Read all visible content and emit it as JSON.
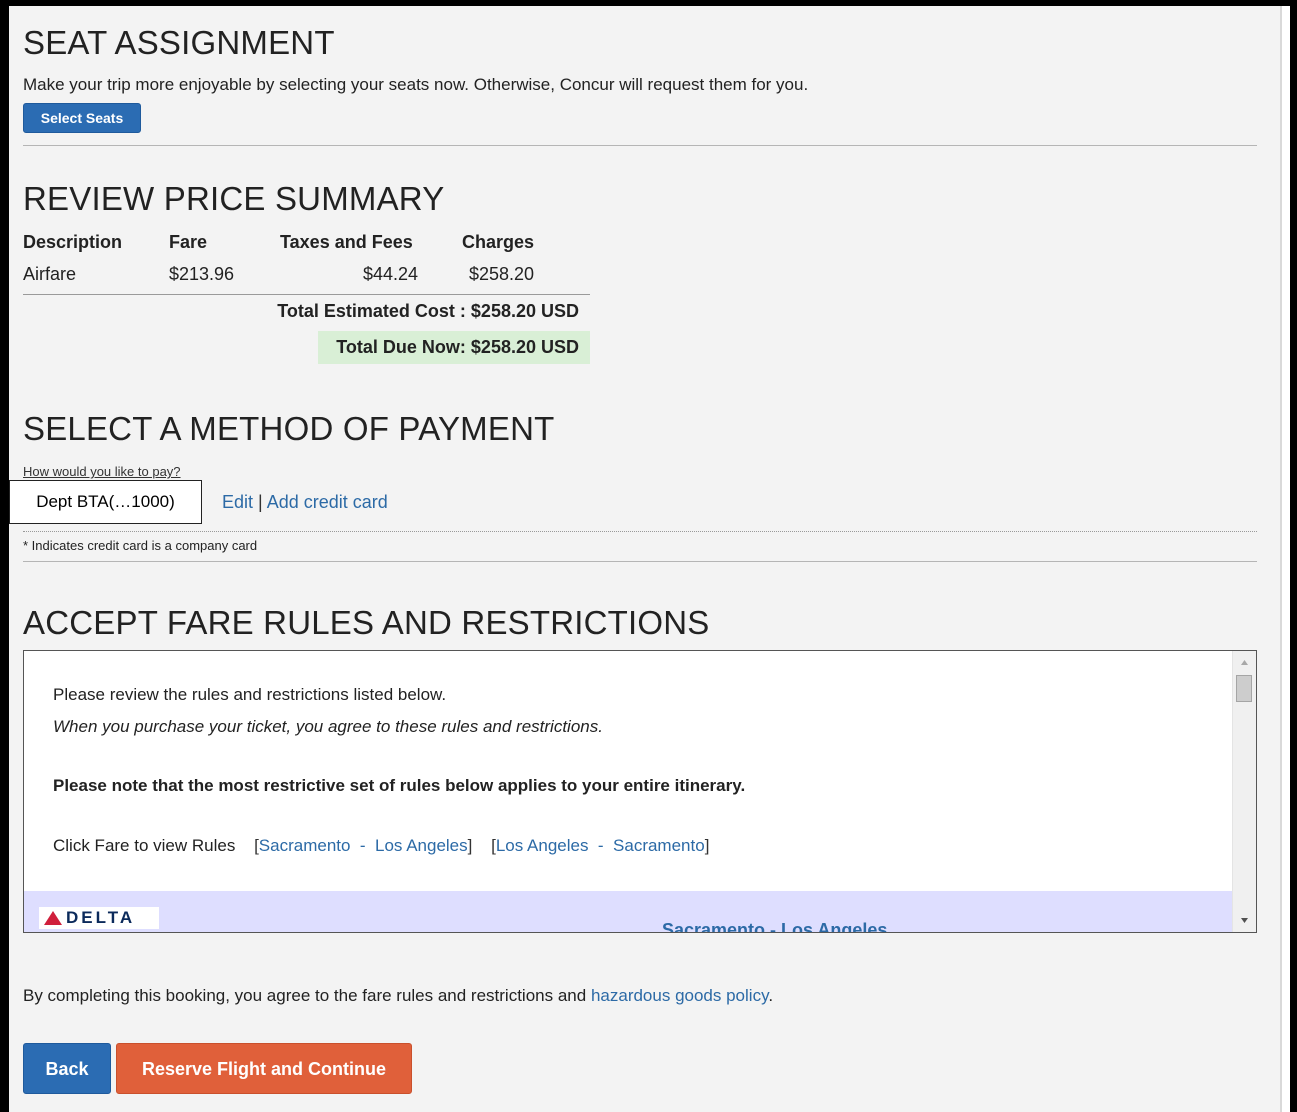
{
  "seat": {
    "heading": "SEAT ASSIGNMENT",
    "description": "Make your trip more enjoyable by selecting your seats now. Otherwise, Concur will request them for you.",
    "select_button": "Select Seats"
  },
  "price": {
    "heading": "REVIEW PRICE SUMMARY",
    "columns": [
      "Description",
      "Fare",
      "Taxes and Fees",
      "Charges"
    ],
    "rows": [
      {
        "description": "Airfare",
        "fare": "$213.96",
        "taxes": "$44.24",
        "charges": "$258.20"
      }
    ],
    "total_estimated": "Total Estimated Cost : $258.20 USD",
    "total_due": "Total Due Now: $258.20 USD"
  },
  "payment": {
    "heading": "SELECT A METHOD OF PAYMENT",
    "question": "How would you like to pay?",
    "selected_card": "Dept BTA(…1000)",
    "edit_link": "Edit",
    "separator": "|",
    "add_card_link": "Add credit card",
    "note": "* Indicates credit card is a company card"
  },
  "rules": {
    "heading": "ACCEPT FARE RULES AND RESTRICTIONS",
    "intro": "Please review the rules and restrictions listed below.",
    "agree_italic": "When you purchase your ticket, you agree to these rules and restrictions.",
    "note_bold": "Please note that the most restrictive set of rules below applies to your entire itinerary.",
    "click_label": "Click Fare to view Rules",
    "route1": "Sacramento  -  Los Angeles",
    "route2": "Los Angeles  -  Sacramento",
    "airline": "DELTA",
    "segment_title": "Sacramento - Los Angeles"
  },
  "footer": {
    "agreement_text": "By completing this booking, you agree to the fare rules and restrictions and",
    "hazard_link": "hazardous goods policy",
    "period": ".",
    "back_button": "Back",
    "reserve_button": "Reserve Flight and Continue"
  },
  "colors": {
    "primary_blue": "#2b6cb3",
    "reserve_orange": "#e0603a",
    "link_blue": "#2c6aa6",
    "total_due_bg": "#d9efd6",
    "segment_bg": "#dedeff",
    "delta_red": "#d01f3c"
  }
}
